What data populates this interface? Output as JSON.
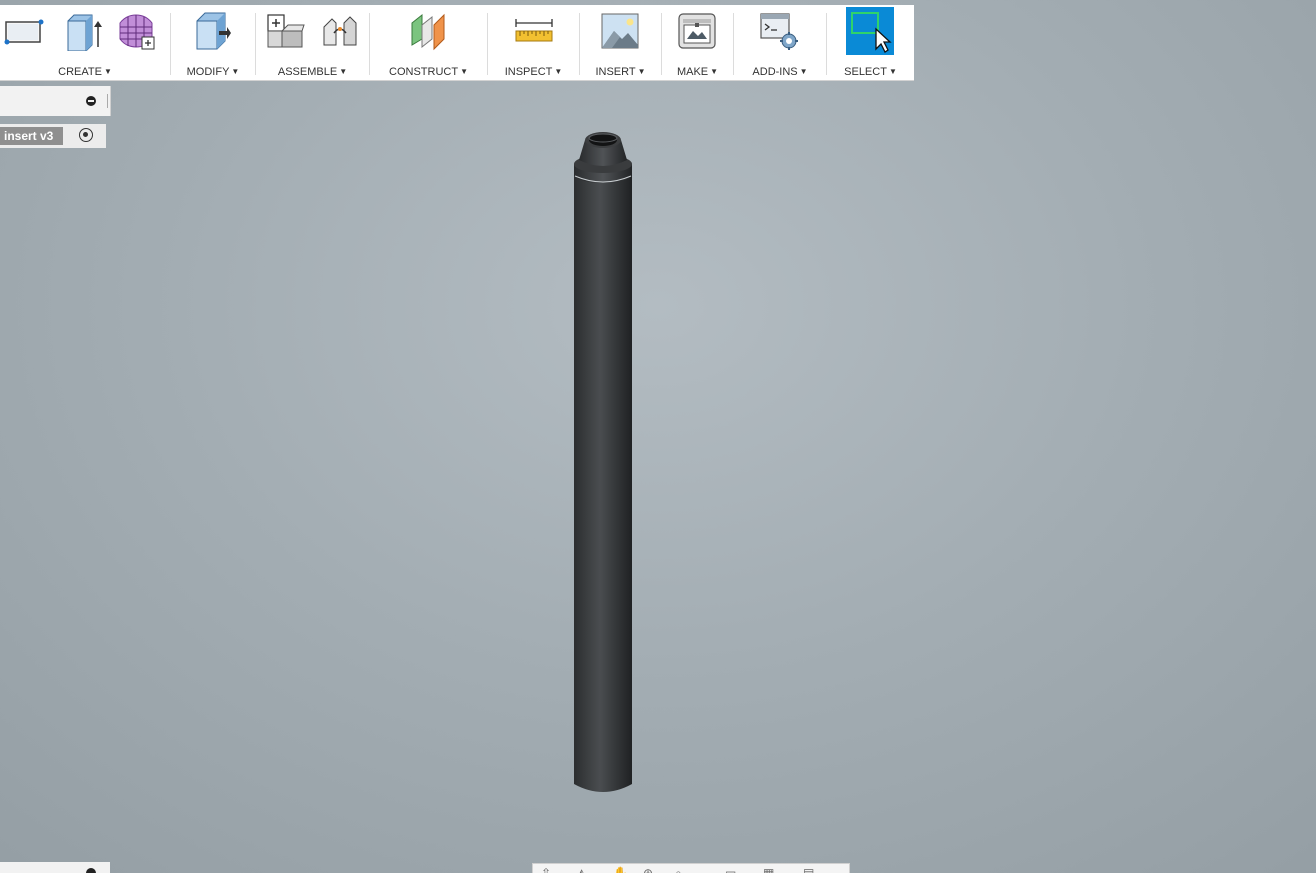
{
  "toolbar": {
    "groups": [
      {
        "label": "CREATE",
        "icons": [
          "sketch-icon",
          "extrude-icon",
          "form-icon"
        ]
      },
      {
        "label": "MODIFY",
        "icons": [
          "press-pull-icon"
        ]
      },
      {
        "label": "ASSEMBLE",
        "icons": [
          "new-component-icon",
          "joint-icon"
        ]
      },
      {
        "label": "CONSTRUCT",
        "icons": [
          "offset-plane-icon"
        ]
      },
      {
        "label": "INSPECT",
        "icons": [
          "measure-icon"
        ]
      },
      {
        "label": "INSERT",
        "icons": [
          "insert-image-icon"
        ]
      },
      {
        "label": "MAKE",
        "icons": [
          "3d-print-icon"
        ]
      },
      {
        "label": "ADD-INS",
        "icons": [
          "scripts-icon"
        ]
      },
      {
        "label": "SELECT",
        "icons": [
          "select-cursor-icon"
        ]
      }
    ],
    "accent": "#0a8ad6"
  },
  "browser": {
    "document_tab": "insert v3"
  },
  "viewport": {
    "model_color": "#3a3c3e",
    "background": "#a3adb3"
  },
  "navigation_bar": {
    "icons": [
      "orbit-icon",
      "look-at-icon",
      "pan-icon",
      "zoom-icon",
      "fit-icon",
      "display-settings-icon",
      "grid-icon",
      "viewports-icon"
    ]
  }
}
